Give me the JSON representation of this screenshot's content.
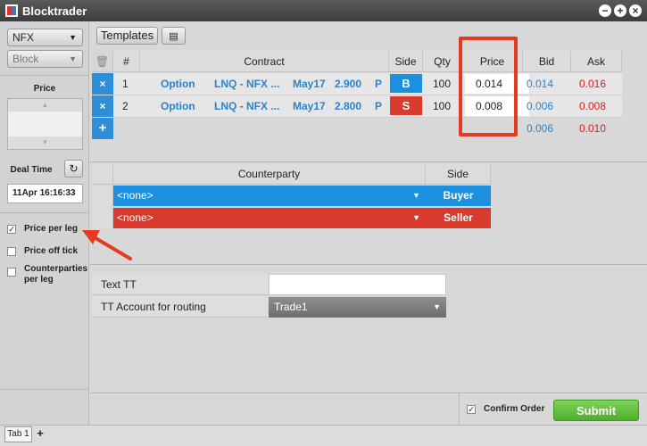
{
  "window": {
    "title": "Blocktrader"
  },
  "left_panel": {
    "exchange_select": "NFX",
    "type_select": "Block",
    "price_label": "Price",
    "deal_time_label": "Deal Time",
    "deal_time_value": "11Apr 16:16:33",
    "options": [
      {
        "label": "Price per leg",
        "checked": true
      },
      {
        "label": "Price off tick",
        "checked": false
      },
      {
        "label": "Counterparties per leg",
        "checked": false
      }
    ]
  },
  "toolbar": {
    "templates_label": "Templates"
  },
  "legs_table": {
    "headers": {
      "num": "#",
      "contract": "Contract",
      "side": "Side",
      "qty": "Qty",
      "price": "Price",
      "bid": "Bid",
      "ask": "Ask"
    },
    "rows": [
      {
        "num": "1",
        "type": "Option",
        "contract": "LNQ - NFX ...",
        "expiry": "May17",
        "strike": "2.900",
        "pc": "P",
        "side": "B",
        "qty": "100",
        "price": "0.014",
        "bid": "0.014",
        "ask": "0.016"
      },
      {
        "num": "2",
        "type": "Option",
        "contract": "LNQ - NFX ...",
        "expiry": "May17",
        "strike": "2.800",
        "pc": "P",
        "side": "S",
        "qty": "100",
        "price": "0.008",
        "bid": "0.006",
        "ask": "0.008"
      }
    ],
    "totals": {
      "bid": "0.006",
      "ask": "0.010"
    },
    "add_label": "+"
  },
  "counterparty_table": {
    "headers": {
      "counterparty": "Counterparty",
      "side": "Side"
    },
    "rows": [
      {
        "value": "<none>",
        "side": "Buyer"
      },
      {
        "value": "<none>",
        "side": "Seller"
      }
    ]
  },
  "routing": {
    "text_tt_label": "Text TT",
    "text_tt_value": "",
    "account_label": "TT Account for routing",
    "account_value": "Trade1"
  },
  "bottom": {
    "confirm_order_label": "Confirm Order",
    "confirm_order_checked": true,
    "submit_label": "Submit"
  },
  "tabs": [
    {
      "label": "Tab 1"
    }
  ],
  "colors": {
    "buy": "#1b8fe0",
    "sell": "#d83a2e",
    "bid_text": "#2a83cc",
    "ask_text": "#d32222",
    "submit": "#5fbf3a",
    "highlight": "#e33a22"
  }
}
